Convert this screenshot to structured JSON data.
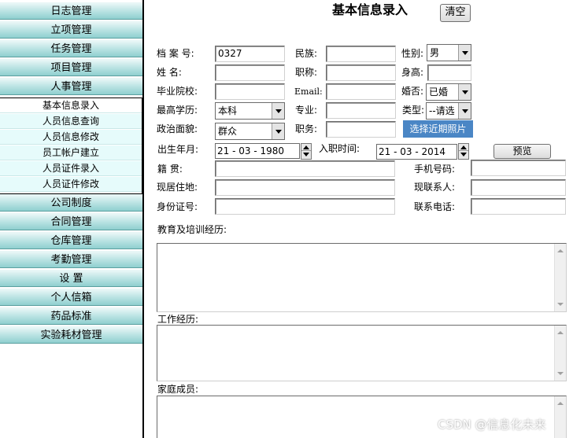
{
  "sidebar": {
    "top_items": [
      "日志管理",
      "立项管理",
      "任务管理",
      "项目管理",
      "人事管理"
    ],
    "sub_items": [
      "基本信息录入",
      "人员信息查询",
      "人员信息修改",
      "员工帐户建立",
      "人员证件录入",
      "人员证件修改"
    ],
    "bottom_items": [
      "公司制度",
      "合同管理",
      "仓库管理",
      "考勤管理",
      "设 置",
      "个人信箱",
      "药品标准",
      "实验耗材管理"
    ]
  },
  "form": {
    "title": "基本信息录入",
    "clear_label": "清空",
    "labels": {
      "archive_no": "档 案 号:",
      "ethnicity": "民族:",
      "gender": "性别:",
      "name": "姓 名:",
      "job_title": "职称:",
      "height": "身高:",
      "school": "毕业院校:",
      "email": "Email:",
      "marital": "婚否:",
      "education": "最高学历:",
      "major": "专业:",
      "type": "类型:",
      "politics": "政治面貌:",
      "position": "职务:",
      "birth_date": "出生年月:",
      "hire_date": "入职时间:",
      "native_place": "籍 贯:",
      "mobile": "手机号码:",
      "address": "现居住地:",
      "contact_person": "现联系人:",
      "id_no": "身份证号:",
      "contact_phone": "联系电话:",
      "education_history": "教育及培训经历:",
      "work_history": "工作经历:",
      "family": "家庭成员:"
    },
    "values": {
      "archive_no": "0327",
      "gender": "男",
      "marital": "已婚",
      "education": "本科",
      "type": "--请选",
      "politics": "群众",
      "birth_date": "21 - 03 - 1980",
      "hire_date": "21 - 03 - 2014"
    },
    "photo_label": "选择近期照片",
    "preview_label": "预览"
  },
  "watermark": "CSDN @信息化未来"
}
